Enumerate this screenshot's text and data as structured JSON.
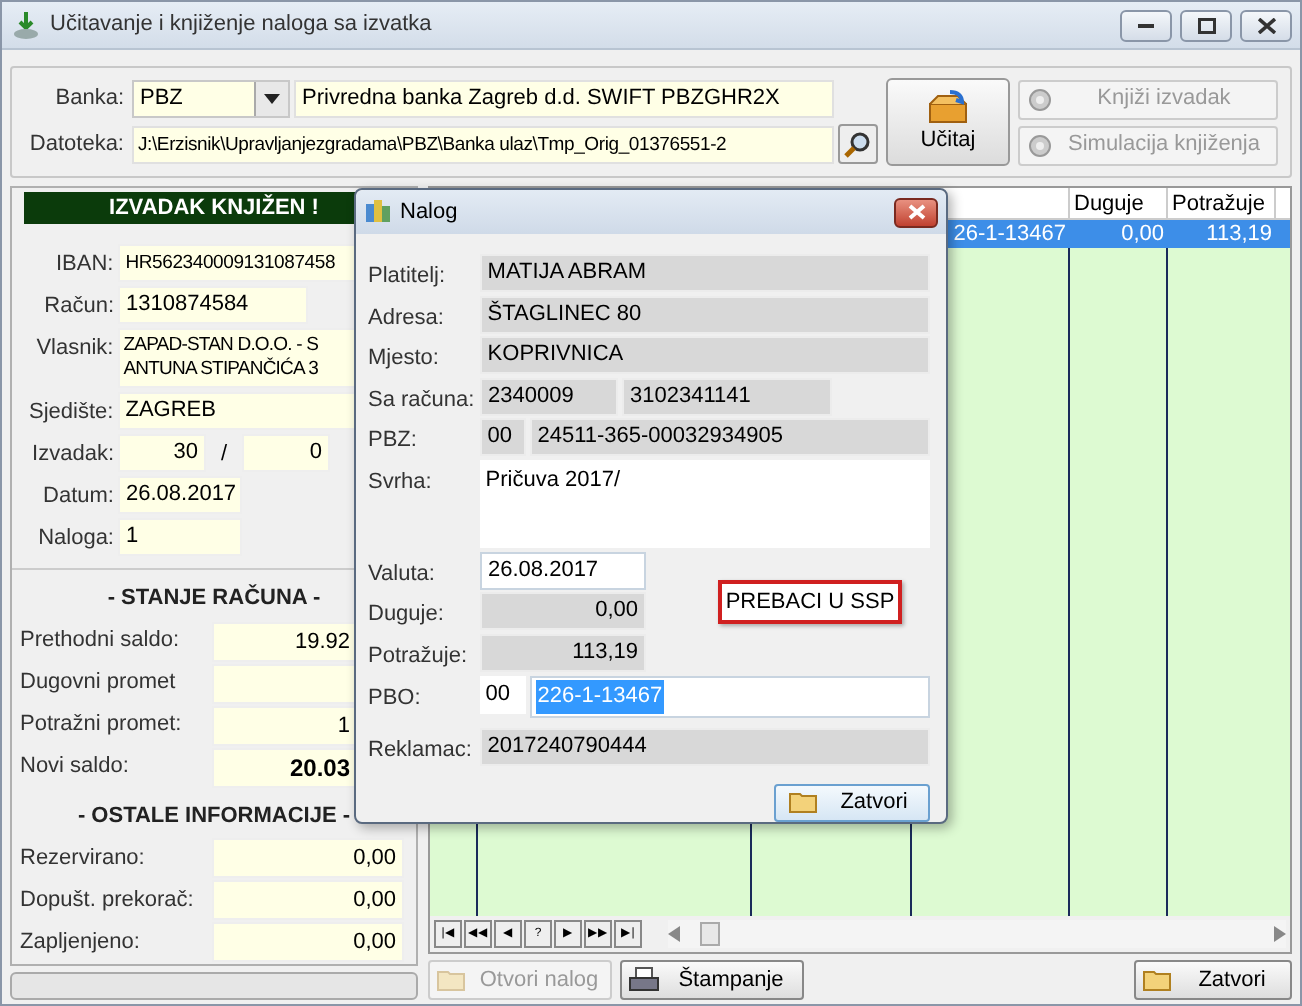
{
  "window": {
    "title": "Učitavanje i knjiženje naloga sa izvatka"
  },
  "header": {
    "bank_label": "Banka:",
    "bank_code": "PBZ",
    "bank_name": "Privredna banka Zagreb d.d. SWIFT PBZGHR2X",
    "file_label": "Datoteka:",
    "file_path": "J:\\Erzisnik\\Upravljanjezgradama\\PBZ\\Banka ulaz\\Tmp_Orig_01376551-2",
    "load_button": "Učitaj",
    "buttons": [
      {
        "label": "Knjiži izvadak",
        "disabled": true
      },
      {
        "label": "Simulacija knjiženja",
        "disabled": true
      }
    ]
  },
  "statement": {
    "banner": "IZVADAK KNJIŽEN !",
    "iban": {
      "label": "IBAN:",
      "value": "HR562340009131087458"
    },
    "account": {
      "label": "Račun:",
      "value": "1310874584"
    },
    "owner": {
      "label": "Vlasnik:",
      "lines": [
        "ZAPAD-STAN D.O.O. - S",
        "ANTUNA STIPANČIĆA 3"
      ]
    },
    "seat": {
      "label": "Sjedište:",
      "value": "ZAGREB"
    },
    "statement_no": {
      "label": "Izvadak:",
      "value": "30",
      "separator": "/",
      "value_2": "0"
    },
    "date": {
      "label": "Datum:",
      "value": "26.08.2017"
    },
    "orders": {
      "label": "Naloga:",
      "value": "1"
    }
  },
  "balance": {
    "title": "- STANJE RAČUNA -",
    "rows": [
      {
        "label": "Prethodni saldo:",
        "value": "19.92",
        "bold": false
      },
      {
        "label": "Dugovni promet",
        "value": ""
      },
      {
        "label": "Potražni promet:",
        "value": "1",
        "bold": false
      },
      {
        "label": "Novi saldo:",
        "value": "20.03",
        "bold": true
      }
    ]
  },
  "other_info": {
    "title": "- OSTALE INFORMACIJE -",
    "rows": [
      {
        "label": "Rezervirano:",
        "value": "0,00"
      },
      {
        "label": "Dopušt. prekorač:",
        "value": "0,00"
      },
      {
        "label": "Zapljenjeno:",
        "value": "0,00"
      }
    ]
  },
  "progress": {
    "level": 0
  },
  "grid": {
    "columns": [
      "",
      "",
      "",
      "",
      "Duguje",
      "Potražuje"
    ],
    "rows": [
      {
        "selected": true,
        "cells": [
          "",
          "",
          "",
          "26-1-13467",
          "0,00",
          "113,19"
        ]
      }
    ],
    "navigator": [
      "|◀",
      "◀◀",
      "◀",
      "?",
      "▶",
      "▶▶",
      "▶|"
    ]
  },
  "bottom_buttons": [
    {
      "label": "Otvori nalog",
      "kind": "open",
      "disabled": true
    },
    {
      "label": "Štampanje",
      "kind": "print",
      "disabled": false
    },
    {
      "label": "Zatvori",
      "kind": "close",
      "disabled": false
    }
  ],
  "dialog": {
    "title": "Nalog",
    "payer": {
      "label": "Platitelj:",
      "value": "MATIJA ABRAM"
    },
    "address": {
      "label": "Adresa:",
      "value": "ŠTAGLINEC 80"
    },
    "place": {
      "label": "Mjesto:",
      "value": "KOPRIVNICA"
    },
    "from_account": {
      "label": "Sa računa:",
      "value": "2340009",
      "value_2": "3102341141"
    },
    "pbz": {
      "label": "PBZ:",
      "value": "00",
      "value_2": "24511-365-00032934905"
    },
    "purpose": {
      "label": "Svrha:",
      "value": "Pričuva 2017/"
    },
    "value_date": {
      "label": "Valuta:",
      "value": "26.08.2017"
    },
    "debit": {
      "label": "Duguje:",
      "value": "0,00"
    },
    "credit": {
      "label": "Potražuje:",
      "value": "113,19"
    },
    "pbo": {
      "label": "PBO:",
      "value": "00",
      "value_2": "226-1-13467"
    },
    "complaint": {
      "label": "Reklamac:",
      "value": "2017240790444"
    },
    "transfer_button": "PREBACI U SSP",
    "close_button": "Zatvori"
  }
}
